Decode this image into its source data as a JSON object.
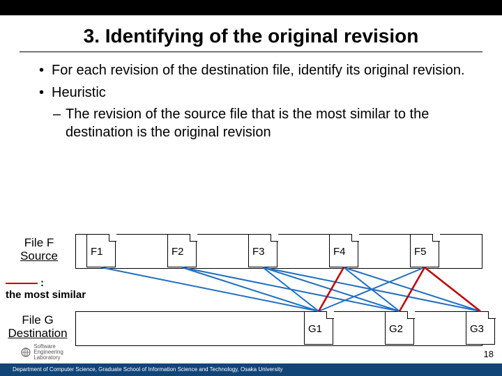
{
  "slide": {
    "title": "3. Identifying of the original revision",
    "bullets": {
      "b1a": "For each revision of the destination file, identify its original revision.",
      "b1b": "Heuristic",
      "b2a": "The revision of the source file that is the most similar to the destination is the original revision"
    },
    "labels": {
      "fileF_line1": "File F",
      "fileF_line2": "Source",
      "fileG_line1": "File G",
      "fileG_line2": "Destination",
      "legend_text": "the most similar",
      "legend_colon": ":"
    },
    "source_revisions": [
      "F1",
      "F2",
      "F3",
      "F4",
      "F5"
    ],
    "dest_revisions": [
      "G1",
      "G2",
      "G3"
    ],
    "page_number": "18",
    "footer": "Department of Computer Science, Graduate School of Information Science and Technology, Osaka University",
    "logo": {
      "line1": "Software",
      "line2": "Engineering",
      "line3": "Laboratory"
    }
  },
  "chart_data": {
    "type": "diagram",
    "title": "Identifying of the original revision",
    "source_file": "File F (Source)",
    "destination_file": "File G (Destination)",
    "source_revisions": [
      "F1",
      "F2",
      "F3",
      "F4",
      "F5"
    ],
    "destination_revisions": [
      "G1",
      "G2",
      "G3"
    ],
    "candidate_edges": [
      [
        "F1",
        "G1"
      ],
      [
        "F2",
        "G1"
      ],
      [
        "F3",
        "G1"
      ],
      [
        "F4",
        "G1"
      ],
      [
        "F5",
        "G1"
      ],
      [
        "F2",
        "G2"
      ],
      [
        "F3",
        "G2"
      ],
      [
        "F4",
        "G2"
      ],
      [
        "F5",
        "G2"
      ],
      [
        "F3",
        "G3"
      ],
      [
        "F4",
        "G3"
      ],
      [
        "F5",
        "G3"
      ]
    ],
    "most_similar_edges": [
      [
        "F4",
        "G1"
      ],
      [
        "F5",
        "G2"
      ],
      [
        "F5",
        "G3"
      ]
    ],
    "legend": "red line : the most similar"
  }
}
